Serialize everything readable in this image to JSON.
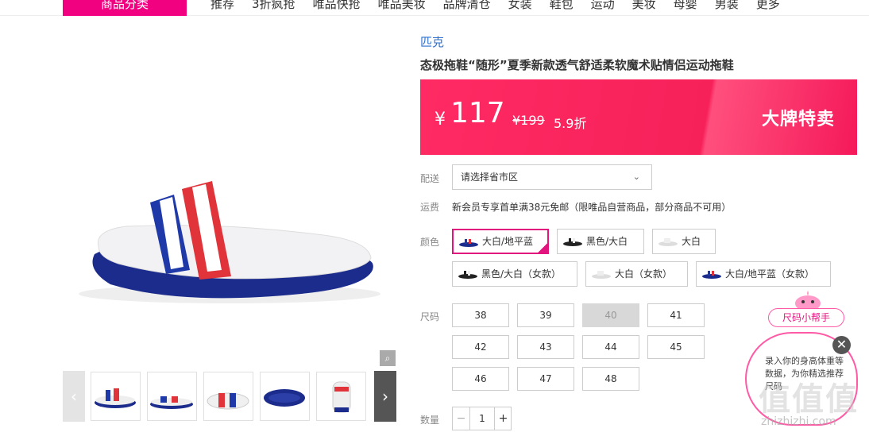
{
  "nav": {
    "category_tab": "商品分类",
    "links": [
      "推荐",
      "3折疯抢",
      "唯品快抢",
      "唯品美妆",
      "品牌清仓",
      "女装",
      "鞋包",
      "运动",
      "美妆",
      "母婴",
      "男装",
      "更多"
    ]
  },
  "product": {
    "brand": "匹克",
    "title": "态极拖鞋“随形”夏季新款透气舒适柔软魔术贴情侣运动拖鞋"
  },
  "price": {
    "currency": "¥",
    "current": "117",
    "original": "¥199",
    "discount": "5.9折",
    "sale_tag": "大牌特卖",
    "bar_color": "#ff2a63"
  },
  "delivery": {
    "label": "配送",
    "placeholder": "请选择省市区"
  },
  "shipping": {
    "label": "运费",
    "text": "新会员专享首单满38元免邮（限唯品自营商品，部分商品不可用）"
  },
  "colors": {
    "label": "颜色",
    "options": [
      "大白/地平蓝",
      "黑色/大白",
      "大白",
      "黑色/大白（女款）",
      "大白（女款）",
      "大白/地平蓝（女款）"
    ],
    "selected": "大白/地平蓝"
  },
  "sizes": {
    "label": "尺码",
    "options": [
      "38",
      "39",
      "40",
      "41",
      "42",
      "43",
      "44",
      "45",
      "46",
      "47",
      "48"
    ],
    "disabled": [
      "40"
    ]
  },
  "quantity": {
    "label": "数量",
    "minus": "−",
    "value": "1",
    "plus": "+"
  },
  "gallery": {
    "zoom_icon": "zoom-icon",
    "prev": "‹",
    "next": "›"
  },
  "helper": {
    "pill": "尺码小帮手",
    "text": "录入你的身高体重等数据，为你精选推荐尺码",
    "close": "✕"
  },
  "watermark": {
    "logo": "值值值",
    "url": "zhizhizhi.com"
  },
  "accent_color": "#e2157f"
}
